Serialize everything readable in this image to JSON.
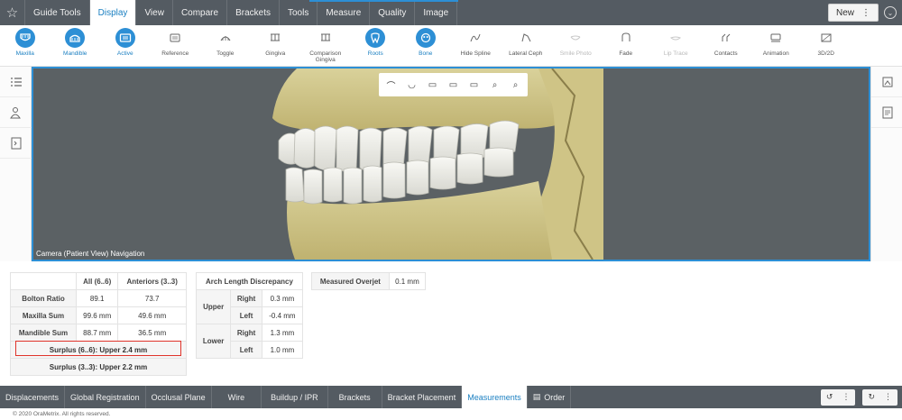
{
  "topbar": {
    "menu": [
      {
        "label": "Guide Tools",
        "active": false
      },
      {
        "label": "Display",
        "active": true
      },
      {
        "label": "View",
        "active": false
      },
      {
        "label": "Compare",
        "active": false
      },
      {
        "label": "Brackets",
        "active": false
      },
      {
        "label": "Tools",
        "active": false
      },
      {
        "label": "Measure",
        "active": false
      },
      {
        "label": "Quality",
        "active": false
      },
      {
        "label": "Image",
        "active": false
      }
    ],
    "new_label": "New",
    "menu_icon": "⋮"
  },
  "toolbar": {
    "tools": [
      {
        "label": "Maxilla",
        "on": true,
        "icon": "jaw-upper-icon"
      },
      {
        "label": "Mandible",
        "on": true,
        "icon": "jaw-lower-icon"
      },
      {
        "label": "Active",
        "on": true,
        "icon": "active-icon"
      },
      {
        "label": "Reference",
        "on": false,
        "icon": "reference-icon"
      },
      {
        "label": "Toggle",
        "on": false,
        "icon": "toggle-icon"
      },
      {
        "label": "Gingiva",
        "on": false,
        "icon": "gingiva-icon"
      },
      {
        "label": "Comparison\nGingiva",
        "on": false,
        "icon": "comparison-gingiva-icon"
      },
      {
        "label": "Roots",
        "on": true,
        "icon": "roots-icon"
      },
      {
        "label": "Bone",
        "on": true,
        "icon": "bone-icon"
      },
      {
        "label": "Hide Spline",
        "on": false,
        "icon": "spline-icon"
      },
      {
        "label": "Lateral Ceph",
        "on": false,
        "icon": "ceph-icon"
      },
      {
        "label": "Smile Photo",
        "on": false,
        "dim": true,
        "icon": "smile-photo-icon"
      },
      {
        "label": "Fade",
        "on": false,
        "icon": "fade-icon"
      },
      {
        "label": "Lip Trace",
        "on": false,
        "dim": true,
        "icon": "lip-trace-icon"
      },
      {
        "label": "Contacts",
        "on": false,
        "icon": "contacts-icon"
      },
      {
        "label": "Animation",
        "on": false,
        "icon": "animation-icon"
      },
      {
        "label": "3D/2D",
        "on": false,
        "icon": "3d-2d-icon"
      }
    ]
  },
  "viewport": {
    "caption": "Camera (Patient View) Navigation"
  },
  "bolton": {
    "headers": [
      "All (6..6)",
      "Anteriors (3..3)"
    ],
    "rows": [
      {
        "label": "Bolton Ratio",
        "all": "89.1",
        "ant": "73.7"
      },
      {
        "label": "Maxilla Sum",
        "all": "99.6 mm",
        "ant": "49.6 mm"
      },
      {
        "label": "Mandible Sum",
        "all": "88.7 mm",
        "ant": "36.5 mm"
      }
    ],
    "surplus_6": "Surplus (6..6): Upper 2.4 mm",
    "surplus_3": "Surplus (3..3): Upper 2.2 mm"
  },
  "arch": {
    "title": "Arch Length Discrepancy",
    "upper": "Upper",
    "lower": "Lower",
    "right": "Right",
    "left": "Left",
    "upper_right": "0.3 mm",
    "upper_left": "-0.4 mm",
    "lower_right": "1.3 mm",
    "lower_left": "1.0 mm"
  },
  "overjet": {
    "label": "Measured Overjet",
    "value": "0.1 mm"
  },
  "bottom": {
    "tabs": [
      {
        "label": "Displacements",
        "active": false
      },
      {
        "label": "Global Registration",
        "active": false
      },
      {
        "label": "Occlusal Plane",
        "active": false
      },
      {
        "label": "Wire",
        "active": false
      },
      {
        "label": "Buildup / IPR",
        "active": false
      },
      {
        "label": "Brackets",
        "active": false
      },
      {
        "label": "Bracket Placement",
        "active": false
      },
      {
        "label": "Measurements",
        "active": true
      },
      {
        "label": "Order",
        "active": false
      }
    ],
    "undo_icon": "↺",
    "redo_icon": "↻",
    "menu_icon": "⋮"
  },
  "footer": "© 2020 OraMetrix. All rights reserved."
}
